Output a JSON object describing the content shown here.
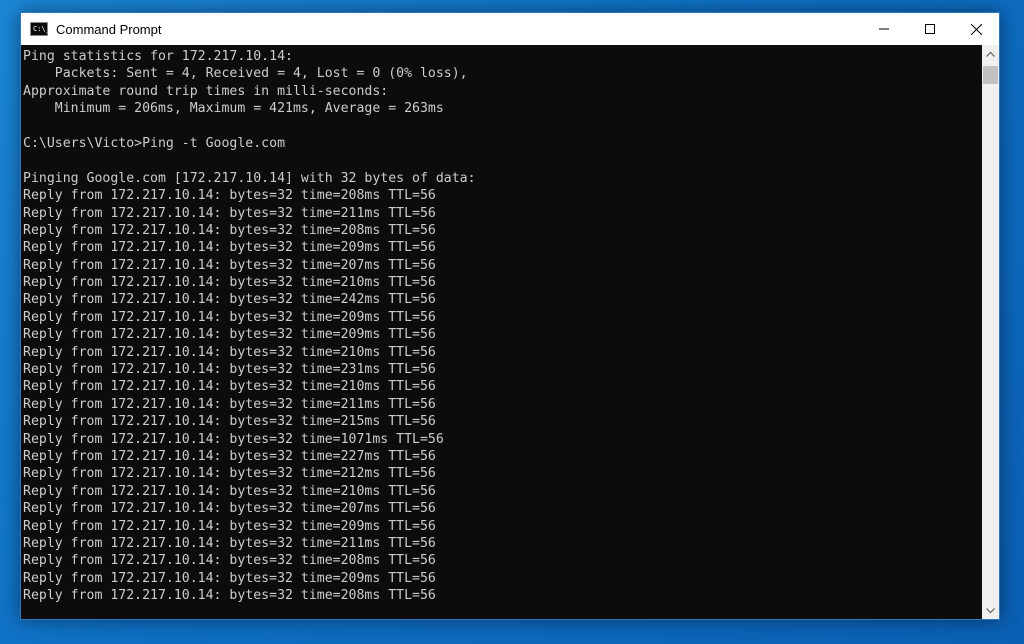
{
  "window": {
    "title": "Command Prompt",
    "icon_label": "C:\\_"
  },
  "caption_buttons": {
    "minimize_icon": "minimize-icon",
    "maximize_icon": "maximize-icon",
    "close_icon": "close-icon"
  },
  "console": {
    "text_color": "#cccccc",
    "background_color": "#0c0c0c",
    "lines": [
      "Ping statistics for 172.217.10.14:",
      "    Packets: Sent = 4, Received = 4, Lost = 0 (0% loss),",
      "Approximate round trip times in milli-seconds:",
      "    Minimum = 206ms, Maximum = 421ms, Average = 263ms",
      "",
      "C:\\Users\\Victo>Ping -t Google.com",
      "",
      "Pinging Google.com [172.217.10.14] with 32 bytes of data:",
      "Reply from 172.217.10.14: bytes=32 time=208ms TTL=56",
      "Reply from 172.217.10.14: bytes=32 time=211ms TTL=56",
      "Reply from 172.217.10.14: bytes=32 time=208ms TTL=56",
      "Reply from 172.217.10.14: bytes=32 time=209ms TTL=56",
      "Reply from 172.217.10.14: bytes=32 time=207ms TTL=56",
      "Reply from 172.217.10.14: bytes=32 time=210ms TTL=56",
      "Reply from 172.217.10.14: bytes=32 time=242ms TTL=56",
      "Reply from 172.217.10.14: bytes=32 time=209ms TTL=56",
      "Reply from 172.217.10.14: bytes=32 time=209ms TTL=56",
      "Reply from 172.217.10.14: bytes=32 time=210ms TTL=56",
      "Reply from 172.217.10.14: bytes=32 time=231ms TTL=56",
      "Reply from 172.217.10.14: bytes=32 time=210ms TTL=56",
      "Reply from 172.217.10.14: bytes=32 time=211ms TTL=56",
      "Reply from 172.217.10.14: bytes=32 time=215ms TTL=56",
      "Reply from 172.217.10.14: bytes=32 time=1071ms TTL=56",
      "Reply from 172.217.10.14: bytes=32 time=227ms TTL=56",
      "Reply from 172.217.10.14: bytes=32 time=212ms TTL=56",
      "Reply from 172.217.10.14: bytes=32 time=210ms TTL=56",
      "Reply from 172.217.10.14: bytes=32 time=207ms TTL=56",
      "Reply from 172.217.10.14: bytes=32 time=209ms TTL=56",
      "Reply from 172.217.10.14: bytes=32 time=211ms TTL=56",
      "Reply from 172.217.10.14: bytes=32 time=208ms TTL=56",
      "Reply from 172.217.10.14: bytes=32 time=209ms TTL=56",
      "Reply from 172.217.10.14: bytes=32 time=208ms TTL=56"
    ]
  },
  "scrollbar": {
    "up_icon": "chevron-up-icon",
    "down_icon": "chevron-down-icon"
  }
}
